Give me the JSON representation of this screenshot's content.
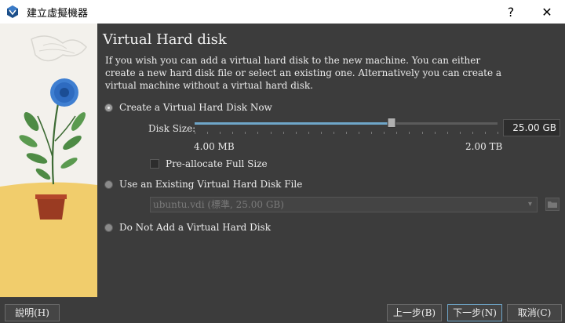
{
  "window": {
    "title": "建立虛擬機器",
    "help_symbol": "?",
    "close_symbol": "✕"
  },
  "page": {
    "title": "Virtual Hard disk",
    "description": "If you wish you can add a virtual hard disk to the new machine. You can either create a new hard disk file or select an existing one. Alternatively you can create a virtual machine without a virtual hard disk."
  },
  "options": {
    "create": {
      "label": "Create a Virtual Hard Disk Now",
      "checked": true
    },
    "existing": {
      "label": "Use an Existing Virtual Hard Disk File",
      "checked": false
    },
    "none": {
      "label": "Do Not Add a Virtual Hard Disk",
      "checked": false
    }
  },
  "disk_size": {
    "label": "Disk Size:",
    "value_text": "25.00 GB",
    "min_label": "4.00 MB",
    "max_label": "2.00 TB",
    "slider_fraction": 0.65
  },
  "preallocate": {
    "label": "Pre-allocate Full Size",
    "checked": false
  },
  "existing_file": {
    "selected": "ubuntu.vdi (標準, 25.00 GB)"
  },
  "buttons": {
    "help": "說明(H)",
    "back": "上一步(B)",
    "next": "下一步(N)",
    "cancel": "取消(C)"
  },
  "icons": {
    "app": "virtualbox-icon",
    "combo_arrow": "▾",
    "folder": "folder-icon"
  },
  "colors": {
    "accent": "#6fa6c9",
    "background": "#3c3c3c"
  }
}
